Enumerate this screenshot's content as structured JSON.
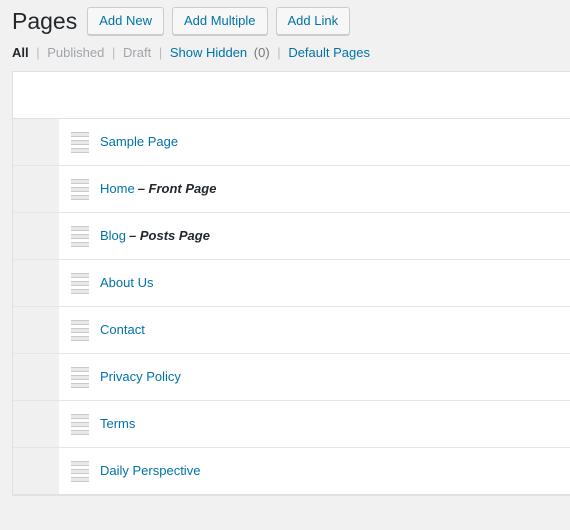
{
  "header": {
    "title": "Pages",
    "buttons": [
      {
        "label": "Add New",
        "name": "add-new-button"
      },
      {
        "label": "Add Multiple",
        "name": "add-multiple-button"
      },
      {
        "label": "Add Link",
        "name": "add-link-button"
      }
    ]
  },
  "filters": {
    "items": [
      {
        "label": "All",
        "state": "current"
      },
      {
        "label": "Published",
        "state": "muted"
      },
      {
        "label": "Draft",
        "state": "muted"
      },
      {
        "label": "Show Hidden",
        "state": "link"
      },
      {
        "label": "Default Pages",
        "state": "link"
      }
    ],
    "hidden_count": "(0)",
    "separator": "|"
  },
  "table": {
    "rows": [
      {
        "title": "Sample Page",
        "note": ""
      },
      {
        "title": "Home",
        "note": "– Front Page"
      },
      {
        "title": "Blog",
        "note": "– Posts Page"
      },
      {
        "title": "About Us",
        "note": ""
      },
      {
        "title": "Contact",
        "note": ""
      },
      {
        "title": "Privacy Policy",
        "note": ""
      },
      {
        "title": "Terms",
        "note": ""
      },
      {
        "title": "Daily Perspective",
        "note": ""
      }
    ]
  },
  "colors": {
    "link": "#0073aa",
    "page_background": "#f1f1f1",
    "row_background": "#ffffff",
    "gutter": "#f0f0f0",
    "title_text": "#23282d",
    "muted_text": "#a0a5aa"
  },
  "icons": {
    "drag_handle": "drag-handle-icon"
  }
}
